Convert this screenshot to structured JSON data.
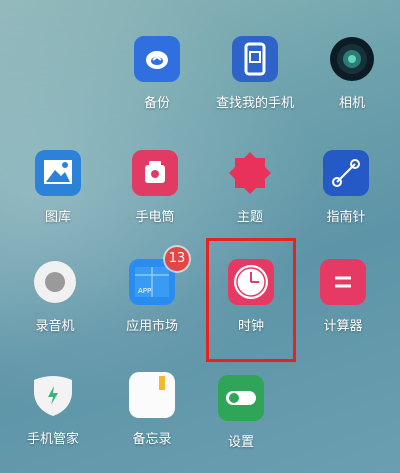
{
  "apps": [
    {
      "id": "backup",
      "label": "备份",
      "icon": "cloud-icon",
      "color": "#2f6fe0"
    },
    {
      "id": "find-phone",
      "label": "查找我的手机",
      "icon": "find-phone-icon",
      "color": "#2e63c9"
    },
    {
      "id": "camera",
      "label": "相机",
      "icon": "camera-lens-icon",
      "color": "#0d1b24"
    },
    {
      "id": "gallery",
      "label": "图库",
      "icon": "gallery-icon",
      "color": "#2c82d8"
    },
    {
      "id": "flashlight",
      "label": "手电筒",
      "icon": "flashlight-icon",
      "color": "#e23b63"
    },
    {
      "id": "theme",
      "label": "主题",
      "icon": "theme-icon",
      "color": "#e8325a"
    },
    {
      "id": "compass",
      "label": "指南针",
      "icon": "compass-icon",
      "color": "#2459c6"
    },
    {
      "id": "recorder",
      "label": "录音机",
      "icon": "recorder-icon",
      "color": "#f1f1f1"
    },
    {
      "id": "app-store",
      "label": "应用市场",
      "icon": "app-store-icon",
      "color": "#2b8cf0",
      "badge": "13"
    },
    {
      "id": "clock",
      "label": "时钟",
      "icon": "clock-icon",
      "color": "#e63a64"
    },
    {
      "id": "calculator",
      "label": "计算器",
      "icon": "calculator-icon",
      "color": "#e63a64"
    },
    {
      "id": "phone-manager",
      "label": "手机管家",
      "icon": "shield-icon",
      "color": "#f3f3f3"
    },
    {
      "id": "memo",
      "label": "备忘录",
      "icon": "memo-icon",
      "color": "#fbfbfb"
    },
    {
      "id": "settings",
      "label": "设置",
      "icon": "toggle-icon",
      "color": "#2fa557"
    }
  ],
  "highlight": {
    "target": "clock",
    "color": "#e8231f"
  }
}
